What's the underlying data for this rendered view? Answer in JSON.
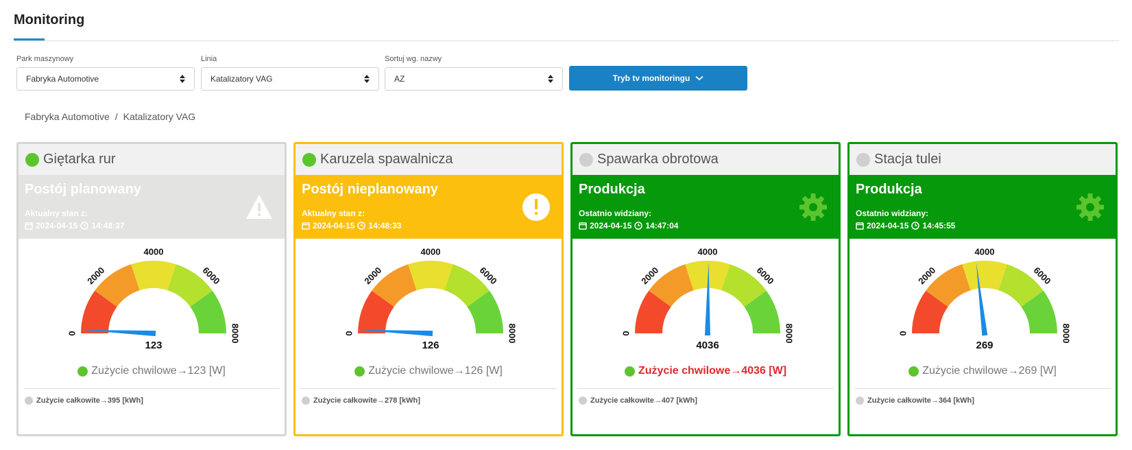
{
  "page": {
    "title": "Monitoring"
  },
  "filters": [
    {
      "label": "Park maszynowy",
      "value": "Fabryka Automotive"
    },
    {
      "label": "Linia",
      "value": "Katalizatory VAG"
    },
    {
      "label": "Sortuj wg. nazwy",
      "value": "AZ"
    }
  ],
  "tv_button": {
    "label": "Tryb tv monitoringu",
    "icon": "chevron-down-icon"
  },
  "breadcrumb": {
    "items": [
      "Fabryka Automotive",
      "Katalizatory VAG"
    ],
    "separator": "/"
  },
  "gauge_scale": {
    "min": 0,
    "max": 8000,
    "ticks": [
      "0",
      "2000",
      "4000",
      "6000",
      "8000"
    ],
    "zone_colors": [
      "#f24a2a",
      "#f49a28",
      "#e8df2e",
      "#b4e02e",
      "#6ad33a"
    ]
  },
  "colors": {
    "online": "#5cc52d",
    "offline": "#cfcfcf",
    "planned": "#e3e3e1",
    "unplanned": "#fcbf0e",
    "production": "#05990b",
    "needle": "#1a8be6",
    "alert_text": "#e0282e",
    "accent": "#1a82c4"
  },
  "cards": [
    {
      "name": "Giętarka rur",
      "online": true,
      "border": "#d5d5d5",
      "status": "Postój planowany",
      "status_bg": "#e3e3e1",
      "status_sub": "Aktualny stan z:",
      "date": "2024-04-15",
      "time": "14:48:37",
      "icon": "warning-icon",
      "value": 123,
      "value_label": "123",
      "reading": "Zużycie chwilowe→123 [W]",
      "alert": false,
      "total": "Zużycie całkowite→395 [kWh]"
    },
    {
      "name": "Karuzela spawalnicza",
      "online": true,
      "border": "#fcbf0e",
      "status": "Postój nieplanowany",
      "status_bg": "#fcbf0e",
      "status_sub": "Aktualny stan z:",
      "date": "2024-04-15",
      "time": "14:48:33",
      "icon": "exclamation-icon",
      "value": 126,
      "value_label": "126",
      "reading": "Zużycie chwilowe→126 [W]",
      "alert": false,
      "total": "Zużycie całkowite→278 [kWh]"
    },
    {
      "name": "Spawarka obrotowa",
      "online": false,
      "border": "#05990b",
      "status": "Produkcja",
      "status_bg": "#05990b",
      "status_sub": "Ostatnio widziany:",
      "date": "2024-04-15",
      "time": "14:47:04",
      "icon": "gear-icon",
      "value": 4036,
      "value_label": "4036",
      "reading": "Zużycie chwilowe→4036 [W]",
      "alert": true,
      "total": "Zużycie całkowite→407 [kWh]"
    },
    {
      "name": "Stacja tulei",
      "online": false,
      "border": "#05990b",
      "status": "Produkcja",
      "status_bg": "#05990b",
      "status_sub": "Ostatnio widziany:",
      "date": "2024-04-15",
      "time": "14:45:55",
      "icon": "gear-icon",
      "value": 3700,
      "value_label": "269",
      "reading": "Zużycie chwilowe→269 [W]",
      "alert": false,
      "total": "Zużycie całkowite→364 [kWh]"
    }
  ]
}
